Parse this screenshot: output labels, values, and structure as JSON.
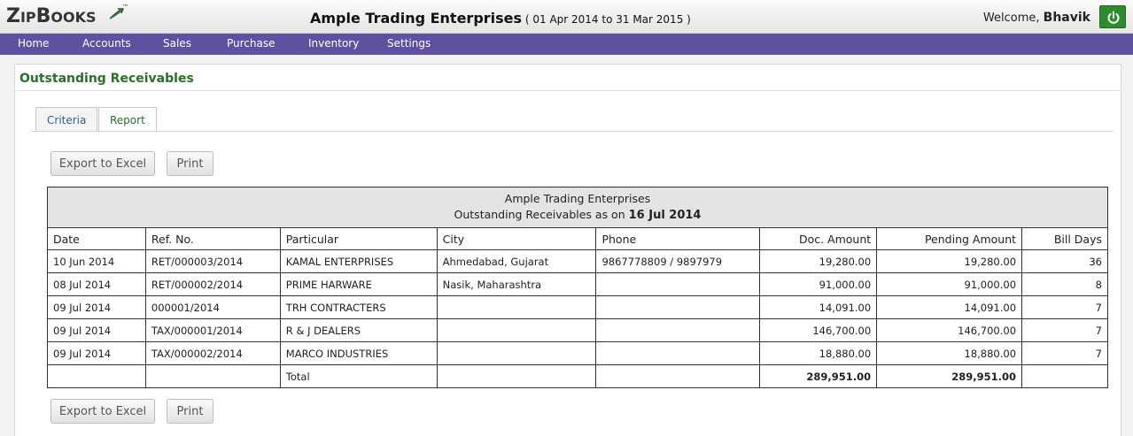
{
  "header": {
    "logo_text": "ZIPBOOKS",
    "logo_tm": "™",
    "company_name": "Ample Trading Enterprises",
    "period": "( 01 Apr 2014 to 31 Mar 2015 )",
    "welcome_label": "Welcome,",
    "user_name": "Bhavik",
    "power_icon": "power-icon"
  },
  "nav": {
    "items": [
      "Home",
      "Accounts",
      "Sales",
      "Purchase",
      "Inventory",
      "Settings"
    ]
  },
  "page": {
    "title": "Outstanding Receivables",
    "tabs": [
      "Criteria",
      "Report"
    ],
    "active_tab": "Report",
    "export_label": "Export to Excel",
    "print_label": "Print"
  },
  "report": {
    "company": "Ample Trading Enterprises",
    "subtitle": "Outstanding Receivables as on",
    "as_on_date": "16 Jul 2014",
    "columns": [
      "Date",
      "Ref. No.",
      "Particular",
      "City",
      "Phone",
      "Doc. Amount",
      "Pending Amount",
      "Bill Days"
    ],
    "rows": [
      [
        "10 Jun 2014",
        "RET/000003/2014",
        "KAMAL ENTERPRISES",
        "Ahmedabad, Gujarat",
        "9867778809 / 9897979",
        "19,280.00",
        "19,280.00",
        "36"
      ],
      [
        "08 Jul 2014",
        "RET/000002/2014",
        "PRIME HARWARE",
        "Nasik, Maharashtra",
        "",
        "91,000.00",
        "91,000.00",
        "8"
      ],
      [
        "09 Jul 2014",
        "000001/2014",
        "TRH CONTRACTERS",
        "",
        "",
        "14,091.00",
        "14,091.00",
        "7"
      ],
      [
        "09 Jul 2014",
        "TAX/000001/2014",
        "R & J DEALERS",
        "",
        "",
        "146,700.00",
        "146,700.00",
        "7"
      ],
      [
        "09 Jul 2014",
        "TAX/000002/2014",
        "MARCO INDUSTRIES",
        "",
        "",
        "18,880.00",
        "18,880.00",
        "7"
      ]
    ],
    "total_label": "Total",
    "total_doc": "289,951.00",
    "total_pending": "289,951.00"
  },
  "colors": {
    "nav_bg": "#6050a0",
    "title_green": "#2a6f2a",
    "power_green": "#2e8b2e"
  }
}
